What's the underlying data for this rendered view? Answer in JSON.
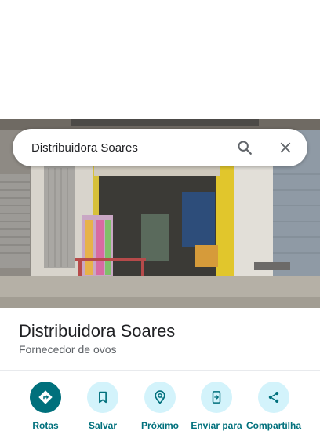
{
  "search": {
    "value": "Distribuidora Soares",
    "search_icon": "search-icon",
    "close_icon": "close-icon"
  },
  "photo": {
    "subject": "storefront photo",
    "colors": {
      "sky": "#9fb3c2",
      "wall": "#d9d6cf",
      "door_frame": "#d6c03a",
      "ground": "#b1aca3"
    }
  },
  "place": {
    "name": "Distribuidora Soares",
    "category": "Fornecedor de ovos"
  },
  "actions": [
    {
      "label": "Rotas",
      "icon": "directions-icon",
      "primary": true
    },
    {
      "label": "Salvar",
      "icon": "bookmark-icon",
      "primary": false
    },
    {
      "label": "Próximo",
      "icon": "nearby-icon",
      "primary": false
    },
    {
      "label": "Enviar para",
      "icon": "send-to-phone-icon",
      "primary": false
    },
    {
      "label": "Compartilha",
      "icon": "share-icon",
      "primary": false
    }
  ],
  "colors": {
    "accent": "#00707c",
    "accent_light": "#d3f3fb",
    "text_primary": "#202124",
    "text_secondary": "#5f6368"
  }
}
